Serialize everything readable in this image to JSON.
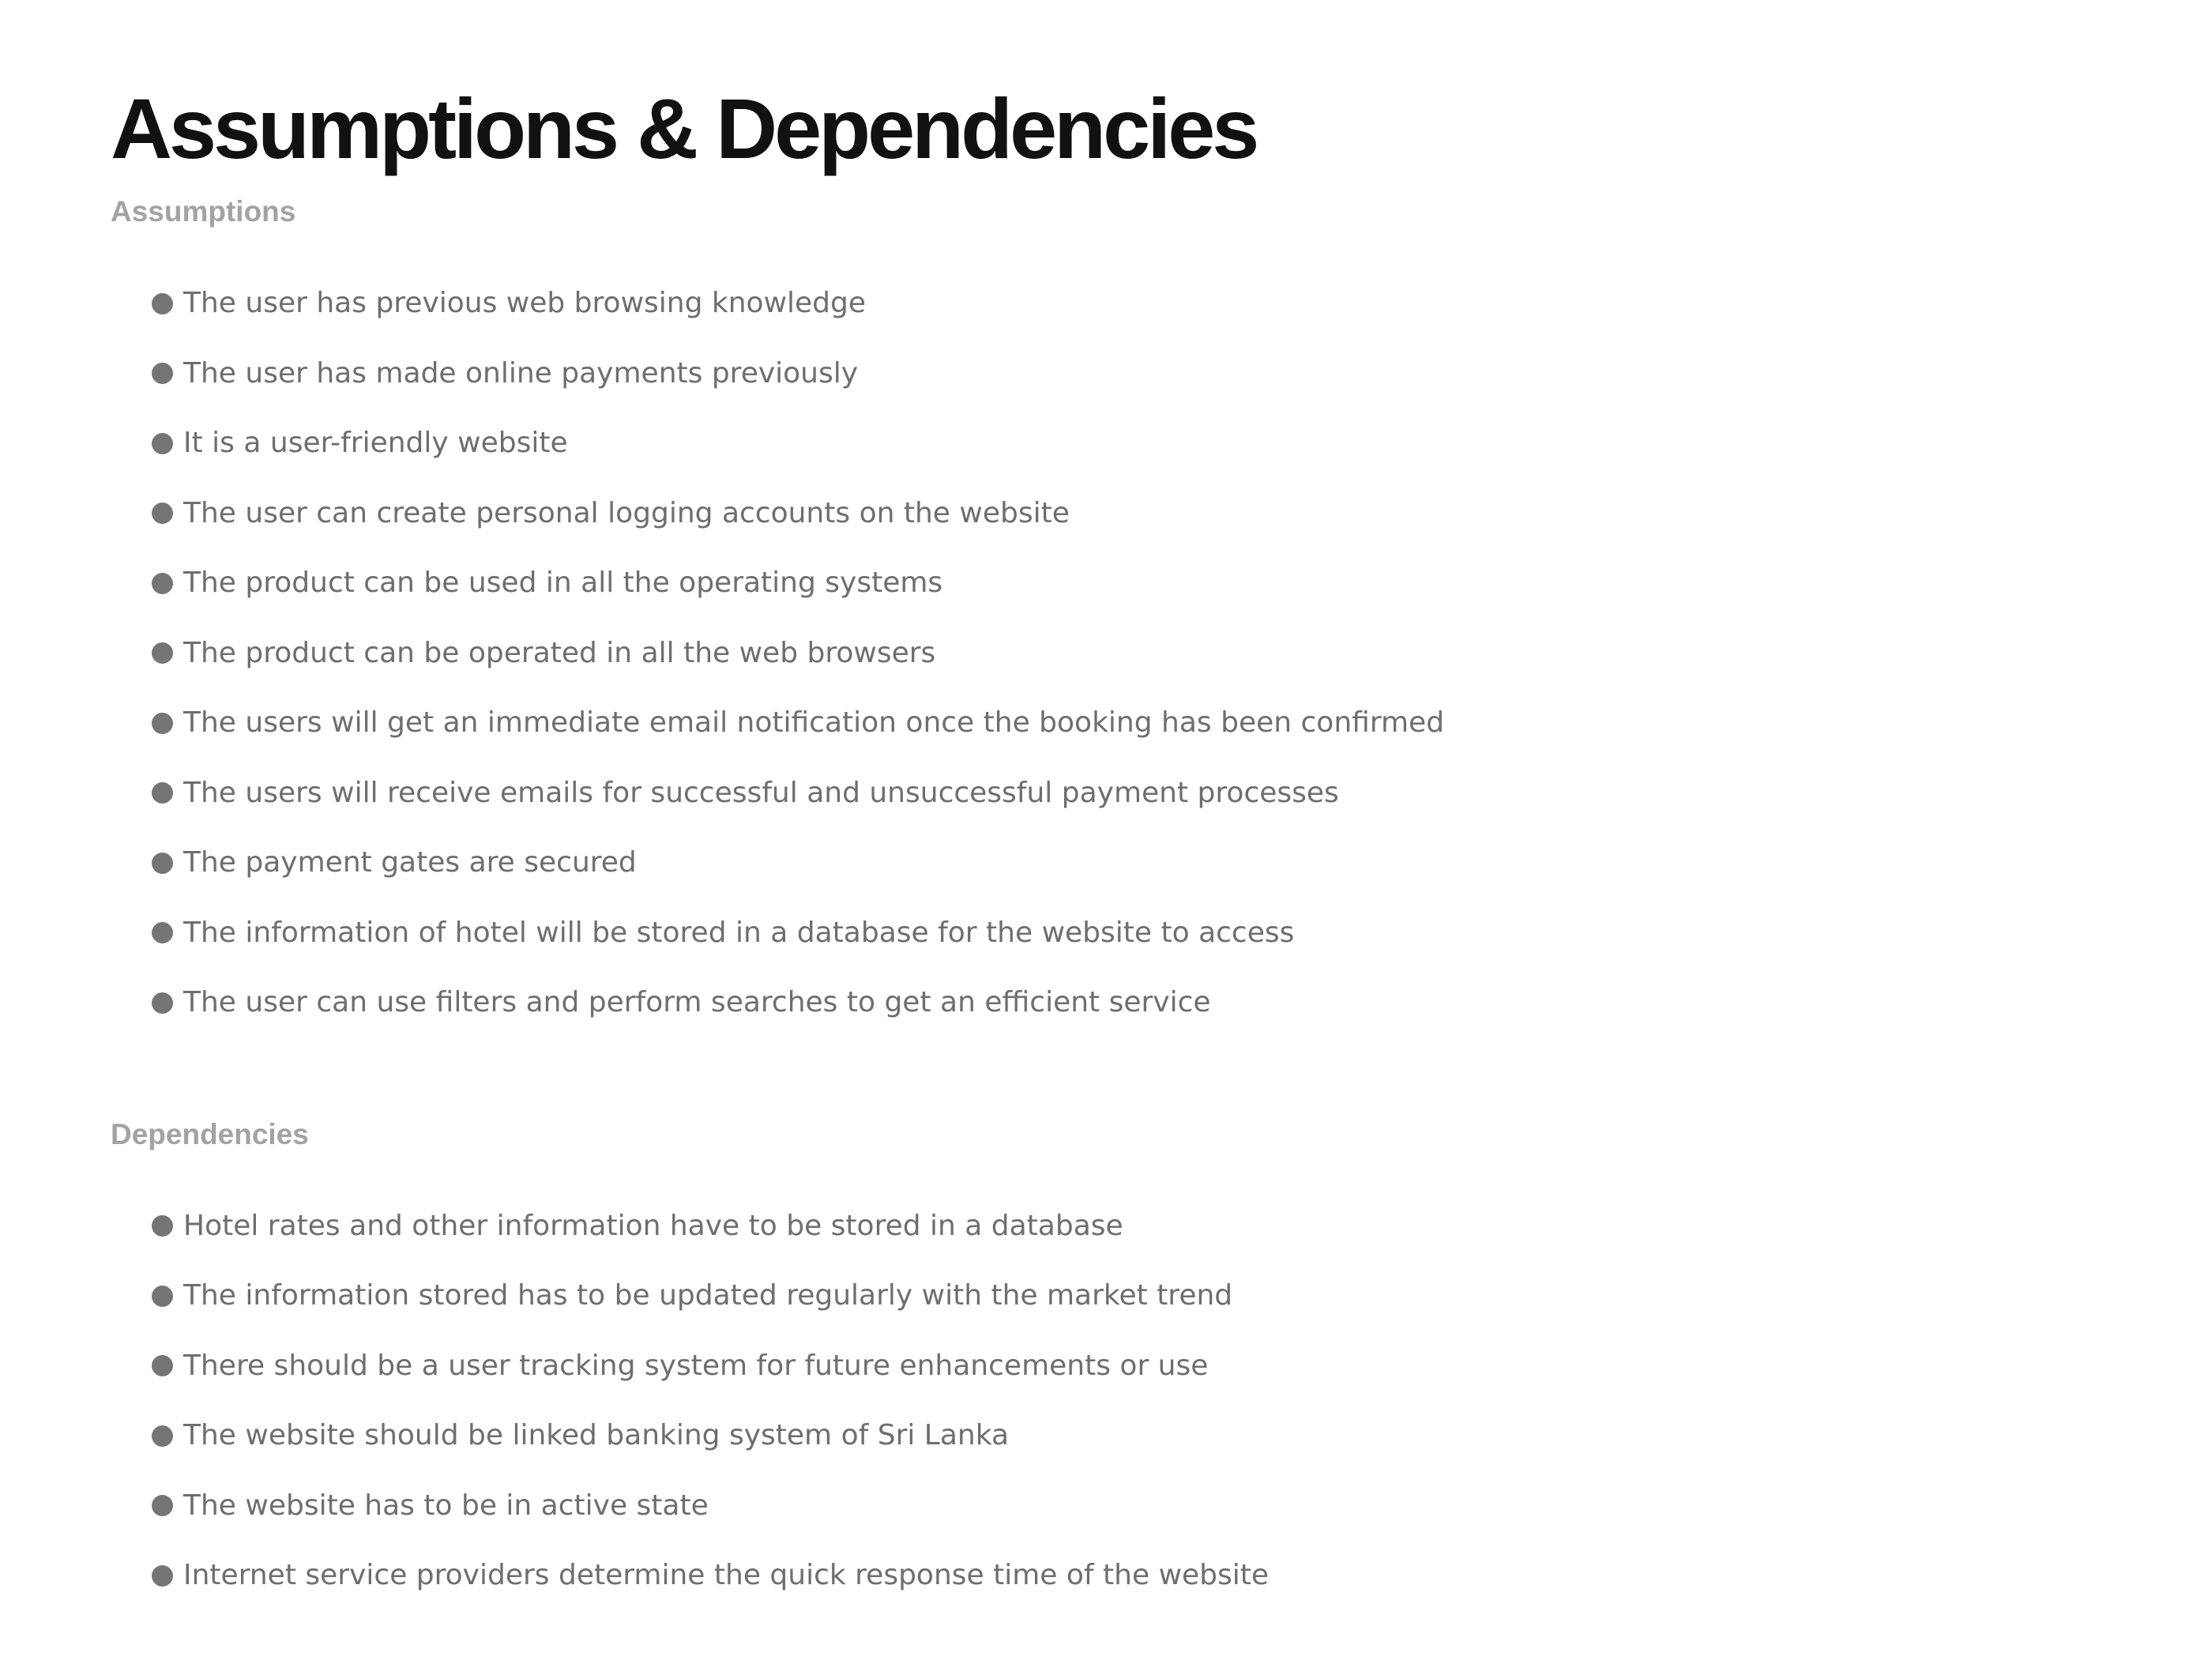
{
  "page": {
    "title": "Assumptions & Dependencies"
  },
  "assumptions": {
    "heading": "Assumptions",
    "items": [
      "The user has previous web browsing knowledge",
      "The user has made online payments previously",
      "It is a user-friendly website",
      "The user can create personal logging accounts on the website",
      "The product can be used in all the operating systems",
      "The product can be operated in all the web browsers",
      "The users will get an immediate email notification once the booking has been confirmed",
      "The users will receive emails for successful and unsuccessful payment processes",
      "The payment gates are secured",
      "The information of hotel will be stored in a database for the website to access",
      "The user can use filters and perform searches to get an efficient service"
    ]
  },
  "dependencies": {
    "heading": "Dependencies",
    "items": [
      "Hotel rates and other information have to be stored in a database",
      "The information stored has to be updated regularly with the market trend",
      "There should be a user tracking system for future enhancements or use",
      "The website should be linked banking system of Sri Lanka",
      "The website has to be in active state",
      "Internet service providers determine the quick response time of the website"
    ]
  },
  "colors": {
    "title": "#111111",
    "section_heading": "#a3a3a3",
    "bullet_text": "#6e6e6e",
    "bullet_dot": "#757575",
    "background": "#ffffff"
  }
}
